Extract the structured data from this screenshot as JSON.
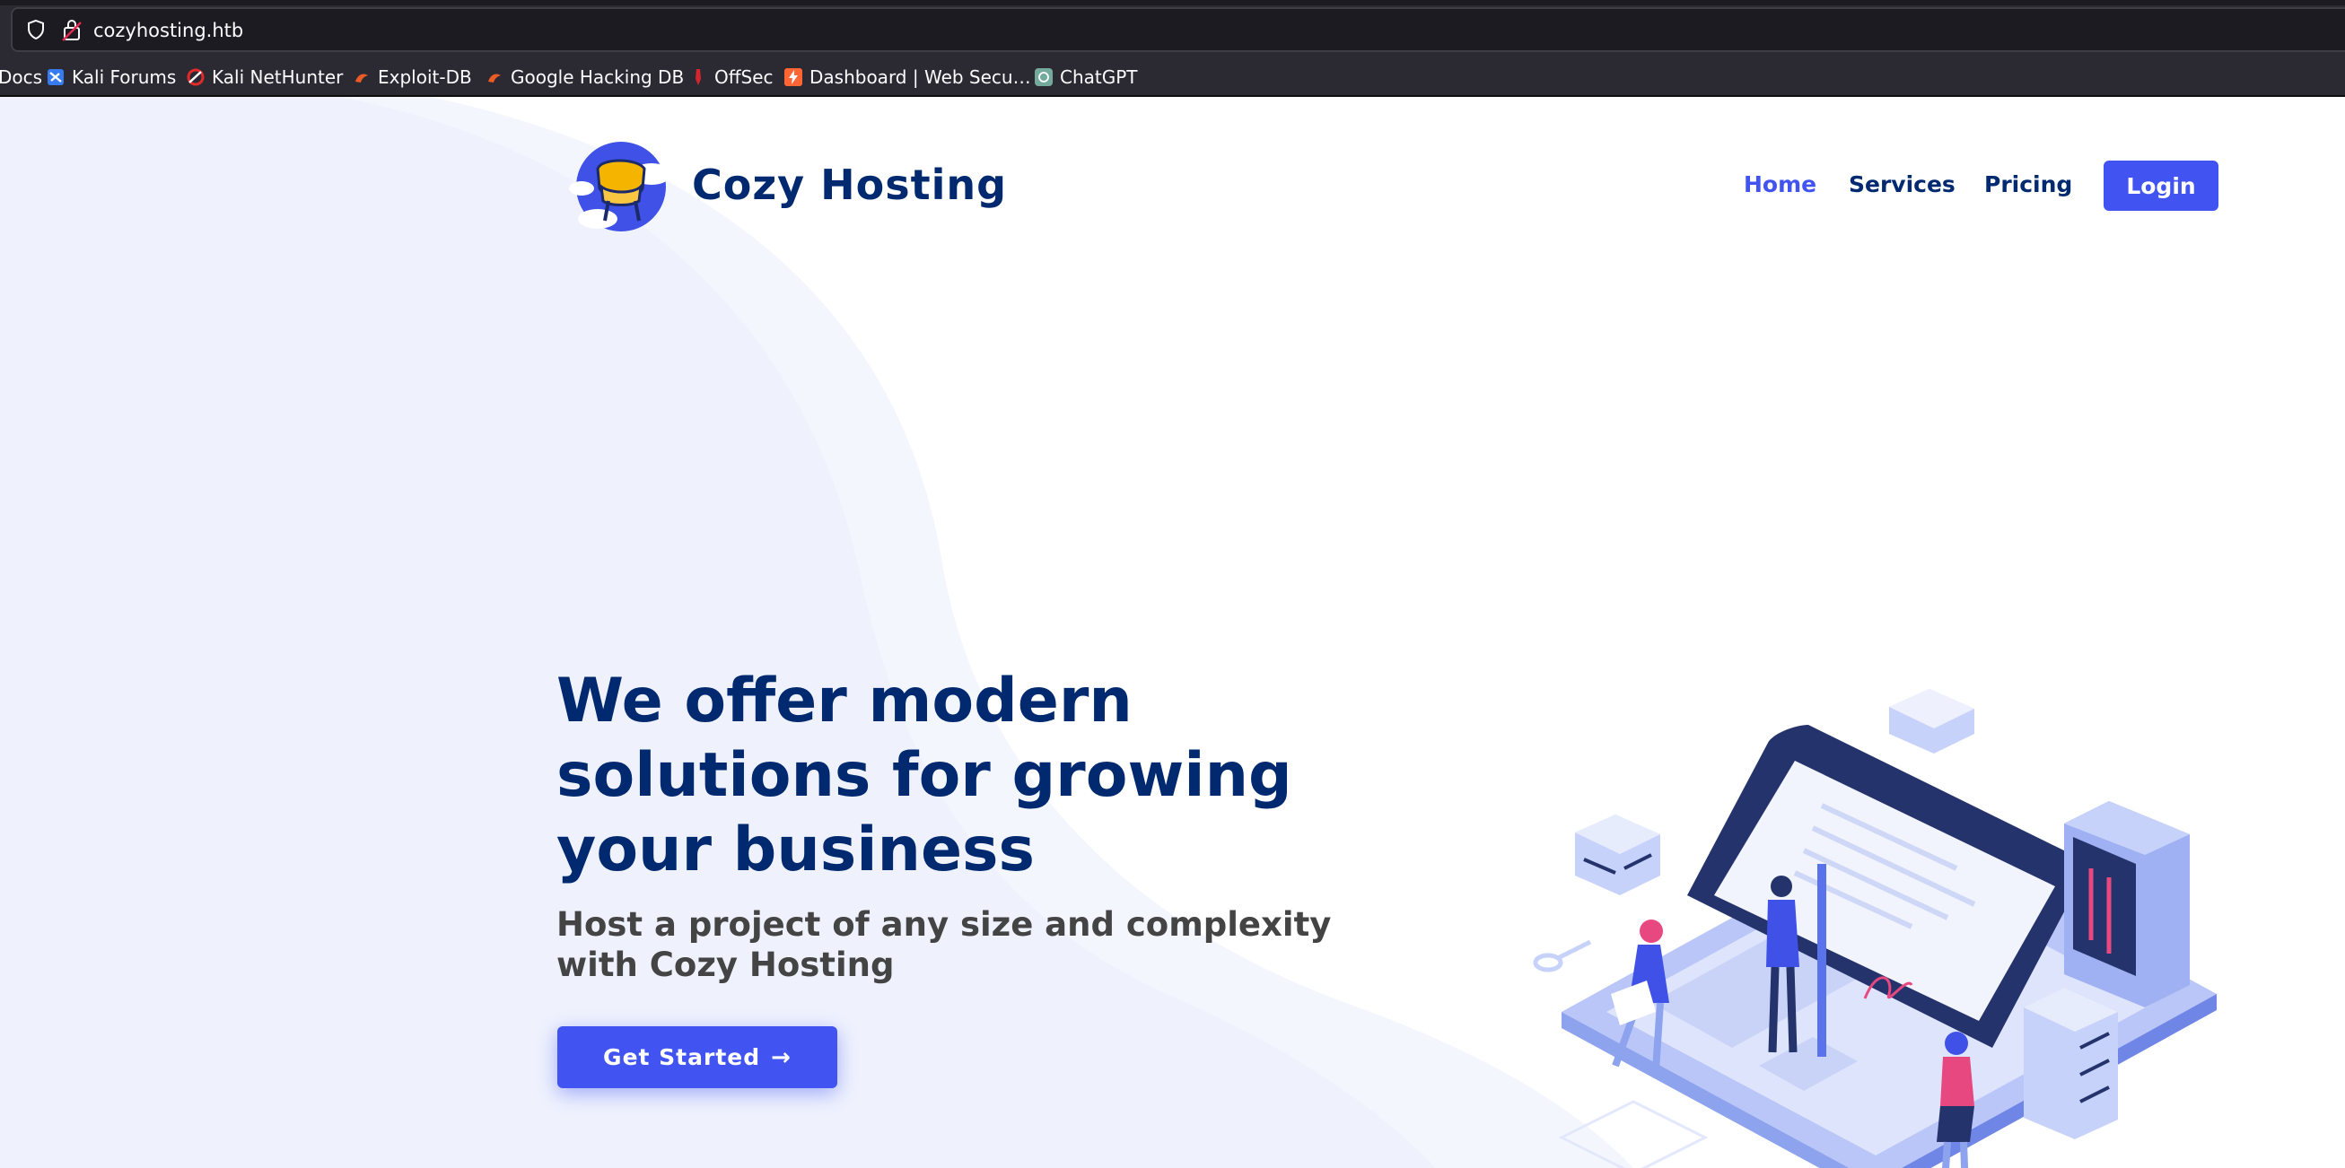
{
  "browser": {
    "url": "cozyhosting.htb",
    "bookmarks": [
      {
        "label": "Docs",
        "icon": "kali-docs-icon"
      },
      {
        "label": "Kali Forums",
        "icon": "kali-forums-icon"
      },
      {
        "label": "Kali NetHunter",
        "icon": "nethunter-icon"
      },
      {
        "label": "Exploit-DB",
        "icon": "exploitdb-icon"
      },
      {
        "label": "Google Hacking DB",
        "icon": "ghdb-icon"
      },
      {
        "label": "OffSec",
        "icon": "offsec-icon"
      },
      {
        "label": "Dashboard | Web Secu…",
        "icon": "portswigger-icon"
      },
      {
        "label": "ChatGPT",
        "icon": "chatgpt-icon"
      }
    ]
  },
  "header": {
    "brand": "Cozy Hosting",
    "nav": [
      {
        "label": "Home",
        "active": true
      },
      {
        "label": "Services",
        "active": false
      },
      {
        "label": "Pricing",
        "active": false
      }
    ],
    "login_label": "Login"
  },
  "hero": {
    "title": "We offer modern solutions for growing your business",
    "subtitle": "Host a project of any size and complexity with Cozy Hosting",
    "cta_label": "Get Started",
    "cta_icon": "arrow-right-icon"
  },
  "colors": {
    "primary": "#4154f1",
    "heading": "#012970",
    "text": "#444444",
    "browser_bg": "#2b2a33"
  }
}
